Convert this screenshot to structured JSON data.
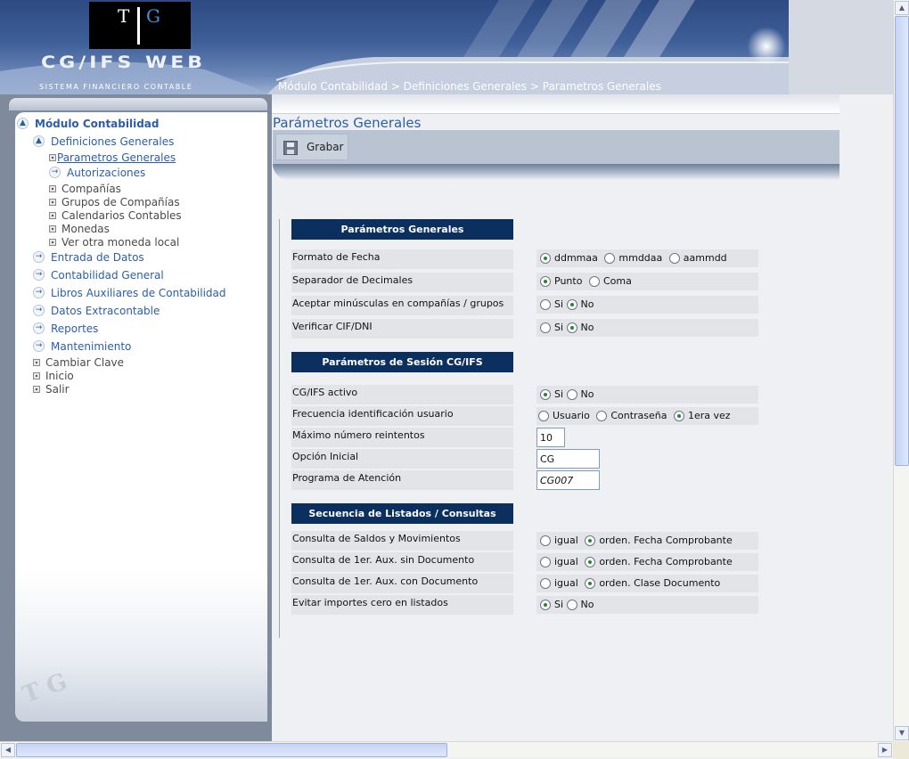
{
  "header": {
    "logo_left": "T",
    "logo_right": "G",
    "brand_name": "CG/IFS WEB",
    "brand_subtitle": "SISTEMA FINANCIERO CONTABLE",
    "breadcrumb": "Módulo Contabilidad > Definiciones Generales > Parametros Generales"
  },
  "sidebar": {
    "root": "Módulo Contabilidad",
    "group": "Definiciones Generales",
    "group_items": [
      "Parametros Generales",
      "Autorizaciones",
      "Compañías",
      "Grupos de Compañías",
      "Calendarios Contables",
      "Monedas",
      "Ver otra moneda local"
    ],
    "sections": [
      "Entrada de Datos",
      "Contabilidad General",
      "Libros Auxiliares de Contabilidad",
      "Datos Extracontable",
      "Reportes",
      "Mantenimiento"
    ],
    "links": [
      "Cambiar Clave",
      "Inicio",
      "Salir"
    ],
    "footer_logo": "T G"
  },
  "main": {
    "title": "Parámetros Generales",
    "save_label": "Grabar",
    "sections": [
      {
        "header": "Parámetros Generales",
        "rows": [
          {
            "label": "Formato de Fecha",
            "options": [
              "ddmmaa",
              "mmddaa",
              "aammdd"
            ],
            "selected": 0
          },
          {
            "label": "Separador de Decimales",
            "options": [
              "Punto",
              "Coma"
            ],
            "selected": 0
          },
          {
            "label": "Aceptar minúsculas en compañías / grupos",
            "options": [
              "Si",
              "No"
            ],
            "selected": 1
          },
          {
            "label": "Verificar CIF/DNI",
            "options": [
              "Si",
              "No"
            ],
            "selected": 1
          }
        ]
      },
      {
        "header": "Parámetros de Sesión CG/IFS",
        "rows": [
          {
            "label": "CG/IFS activo",
            "options": [
              "Si",
              "No"
            ],
            "selected": 0
          },
          {
            "label": "Frecuencia identificación usuario",
            "options": [
              "Usuario",
              "Contraseña",
              "1era vez"
            ],
            "selected": 2
          },
          {
            "label": "Máximo número reintentos",
            "input": "10"
          },
          {
            "label": "Opción Inicial",
            "input": "CG"
          },
          {
            "label": "Programa de Atención",
            "input": "CG007"
          }
        ]
      },
      {
        "header": "Secuencia de Listados / Consultas",
        "rows": [
          {
            "label": "Consulta de Saldos y Movimientos",
            "options": [
              "igual",
              "orden. Fecha Comprobante"
            ],
            "selected": 1
          },
          {
            "label": "Consulta de 1er. Aux. sin Documento",
            "options": [
              "igual",
              "orden. Fecha Comprobante"
            ],
            "selected": 1
          },
          {
            "label": "Consulta de 1er. Aux. con Documento",
            "options": [
              "igual",
              "orden. Clase Documento"
            ],
            "selected": 1
          },
          {
            "label": "Evitar importes cero en listados",
            "options": [
              "Si",
              "No"
            ],
            "selected": 0
          }
        ]
      }
    ]
  },
  "colors": {
    "accent": "#2b5ea7",
    "section_header": "#0b2f5e",
    "radio_selected": "#1f8a2a"
  }
}
